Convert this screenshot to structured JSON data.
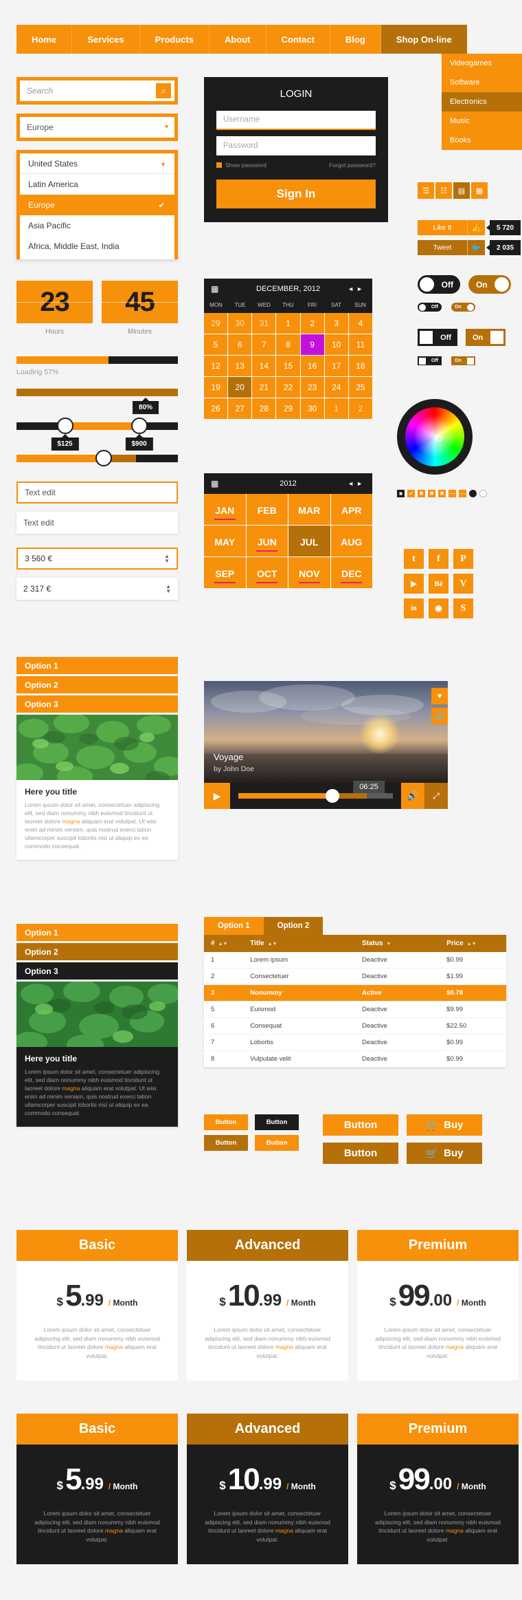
{
  "colors": {
    "accent": "#f7900b",
    "accent_dark": "#b5700a",
    "dark": "#1c1c1c",
    "magenta": "#c410d8"
  },
  "nav": {
    "items": [
      "Home",
      "Services",
      "Products",
      "About",
      "Contact",
      "Blog"
    ],
    "shop_label": "Shop On-line",
    "submenu": [
      "Videogames",
      "Software",
      "Electronics",
      "Music",
      "Books"
    ],
    "submenu_selected": "Electronics"
  },
  "search": {
    "placeholder": "Search",
    "icon": "search-icon"
  },
  "select": {
    "value": "Europe"
  },
  "dropdown": {
    "head": "United States",
    "items": [
      "Latin America",
      "Europe",
      "Asia Pacific",
      "Africa, Middle East, India"
    ],
    "selected": "Europe"
  },
  "timer": {
    "hours_value": "23",
    "hours_label": "Hours",
    "minutes_value": "45",
    "minutes_label": "Minutes"
  },
  "progress": {
    "percent": 57,
    "label": "Loading 57%"
  },
  "sliders": {
    "bar_full_pct": 100,
    "tooltip_80": "80%",
    "range_low": "$125",
    "range_low_pct": 30,
    "range_high": "$900",
    "range_high_pct": 76,
    "single_pct": 54
  },
  "inputs": {
    "text_focus": "Text edit",
    "text_plain": "Text edit",
    "spinner_orange": "3 560 €",
    "spinner_plain": "2 317 €"
  },
  "accordion_light": {
    "items": [
      "Option 1",
      "Option 2",
      "Option 3"
    ]
  },
  "accordion_dark": {
    "items": [
      "Option 1",
      "Option 2",
      "Option 3"
    ]
  },
  "card_light": {
    "title": "Here you title",
    "text_before": "Lorem ipsum dolor sit amet, consectetuer adipiscing elit, sed diam nonummy nibh euismod tincidunt ut laoreet dolore ",
    "highlight": "magna",
    "text_after": " aliquam erat volutpat. Ut wisi enim ad minim veniam, quis nostrud exerci tation ullamcorper suscipit lobortis nisl ut aliquip ex ea commodo consequat."
  },
  "card_dark": {
    "title": "Here you title",
    "text_before": "Lorem ipsum dolor sit amet, consectetuer adipiscing elit, sed diam nonummy nibh euismod tincidunt ut laoreet dolore ",
    "highlight": "magna",
    "text_after": " aliquam erat volutpat. Ut wisi enim ad minim veniam, quis nostrud exerci tation ullamcorper suscipit lobortis nisl ut aliquip ex ea commodo consequat."
  },
  "login": {
    "title": "LOGIN",
    "username_placeholder": "Username",
    "password_placeholder": "Password",
    "show_password": "Show password",
    "forgot": "Forgot password?",
    "submit": "Sign In"
  },
  "calendar": {
    "title": "DECEMBER, 2012",
    "icon": "calendar-icon",
    "prev": "◄",
    "next": "►",
    "dow": [
      "MON",
      "TUE",
      "WED",
      "THU",
      "FRI",
      "SAT",
      "SUN"
    ],
    "weeks": [
      [
        "29",
        "30",
        "31",
        "1",
        "2",
        "3",
        "4"
      ],
      [
        "5",
        "6",
        "7",
        "8",
        "9",
        "10",
        "11"
      ],
      [
        "12",
        "13",
        "14",
        "15",
        "16",
        "17",
        "18"
      ],
      [
        "19",
        "20",
        "21",
        "22",
        "23",
        "24",
        "25"
      ],
      [
        "26",
        "27",
        "28",
        "29",
        "30",
        "1",
        "2"
      ]
    ],
    "muted": [
      "29",
      "30",
      "31",
      "1",
      "2",
      "3",
      "4"
    ],
    "selected_day": "9",
    "hover_day": "20"
  },
  "monthpicker": {
    "title": "2012",
    "icon": "calendar-icon",
    "prev": "◄",
    "next": "►",
    "months": [
      "JAN",
      "FEB",
      "MAR",
      "APR",
      "MAY",
      "JUN",
      "JUL",
      "AUG",
      "SEP",
      "OCT",
      "NOV",
      "DEC"
    ],
    "hover_month": "JUL",
    "underlined": [
      "JAN",
      "JUN",
      "SEP",
      "OCT",
      "NOV",
      "DEC"
    ]
  },
  "viewtoggle": {
    "items": [
      "list-view-icon",
      "bullet-list-icon",
      "detail-list-icon",
      "grid-view-icon"
    ],
    "glyphs": [
      "☰",
      "☷",
      "▤",
      "▦"
    ],
    "selected_index": 2
  },
  "share": {
    "like_label": "Like It",
    "like_icon": "thumbs-up-icon",
    "like_count": "5 720",
    "tweet_label": "Tweet",
    "tweet_icon": "twitter-bird-icon",
    "tweet_count": "2 035"
  },
  "toggles": {
    "off_label": "Off",
    "on_label": "On"
  },
  "colorpicker": {
    "swatch_glyphs": [
      "■",
      "✔",
      "✖",
      "✖",
      "✖",
      "—",
      "—",
      "●",
      "○"
    ]
  },
  "social": {
    "row1": [
      "twitter-icon",
      "facebook-icon",
      "pinterest-icon"
    ],
    "row1_glyphs": [
      "t",
      "f",
      "P"
    ],
    "row2": [
      "youtube-icon",
      "behance-icon",
      "vimeo-icon"
    ],
    "row2_glyphs": [
      "▶",
      "Bē",
      "V"
    ],
    "row3": [
      "linkedin-icon",
      "dribbble-icon",
      "skype-icon"
    ],
    "row3_glyphs": [
      "in",
      "◉",
      "S"
    ]
  },
  "video": {
    "title": "Voyage",
    "author": "by John Doe",
    "time": "06:25",
    "play_icon": "play-icon",
    "sound_icon": "speaker-icon",
    "expand_icon": "expand-icon",
    "heart_icon": "heart-icon",
    "link_icon": "link-icon"
  },
  "table": {
    "tabs": [
      {
        "label": "Option 1",
        "active": true
      },
      {
        "label": "Option 2",
        "active": false
      }
    ],
    "columns": [
      "#",
      "Title",
      "Status",
      "Price"
    ],
    "rows": [
      {
        "num": "1",
        "title": "Lorem ipsum",
        "status": "Deactive",
        "price": "$0.99",
        "active": false
      },
      {
        "num": "2",
        "title": "Consectetuer",
        "status": "Deactive",
        "price": "$1.99",
        "active": false
      },
      {
        "num": "3",
        "title": "Nonummy",
        "status": "Active",
        "price": "$0.78",
        "active": true
      },
      {
        "num": "5",
        "title": "Euismod",
        "status": "Deactive",
        "price": "$9.99",
        "active": false
      },
      {
        "num": "6",
        "title": "Consequat",
        "status": "Deactive",
        "price": "$22.50",
        "active": false
      },
      {
        "num": "7",
        "title": "Lobortis",
        "status": "Deactive",
        "price": "$0.99",
        "active": false
      },
      {
        "num": "8",
        "title": "Vulputate velit",
        "status": "Deactive",
        "price": "$0.99",
        "active": false
      }
    ]
  },
  "buttons": {
    "small": "Button",
    "large": "Button",
    "buy": "Buy",
    "cart_icon": "shopping-cart-icon"
  },
  "pricing_light": [
    {
      "name": "Basic",
      "style": "orange",
      "currency": "$",
      "integer": "5",
      "decimal": ".99",
      "period": "/ Month",
      "text_before": "Lorem ipsum dolor sit amet, consectetuer adipiscing elit, sed diam nonummy nibh euismod tincidunt ut laoreet dolore ",
      "highlight": "magna",
      "text_after": " aliquam erat volutpat."
    },
    {
      "name": "Advanced",
      "style": "dark",
      "currency": "$",
      "integer": "10",
      "decimal": ".99",
      "period": "/ Month",
      "text_before": "Lorem ipsum dolor sit amet, consectetuer adipiscing elit, sed diam nonummy nibh euismod tincidunt ut laoreet dolore ",
      "highlight": "magna",
      "text_after": " aliquam erat volutpat."
    },
    {
      "name": "Premium",
      "style": "orange",
      "currency": "$",
      "integer": "99",
      "decimal": ".00",
      "period": "/ Month",
      "text_before": "Lorem ipsum dolor sit amet, consectetuer adipiscing elit, sed diam nonummy nibh euismod tincidunt ut laoreet dolore ",
      "highlight": "magna",
      "text_after": " aliquam erat volutpat."
    }
  ],
  "pricing_dark": [
    {
      "name": "Basic",
      "style": "orange",
      "currency": "$",
      "integer": "5",
      "decimal": ".99",
      "period": "/ Month",
      "text_before": "Lorem ipsum dolor sit amet, consectetuer adipiscing elit, sed diam nonummy nibh euismod tincidunt ut laoreet dolore ",
      "highlight": "magna",
      "text_after": " aliquam erat volutpat."
    },
    {
      "name": "Advanced",
      "style": "dark",
      "currency": "$",
      "integer": "10",
      "decimal": ".99",
      "period": "/ Month",
      "text_before": "Lorem ipsum dolor sit amet, consectetuer adipiscing elit, sed diam nonummy nibh euismod tincidunt ut laoreet dolore ",
      "highlight": "magna",
      "text_after": " aliquam erat volutpat."
    },
    {
      "name": "Premium",
      "style": "orange",
      "currency": "$",
      "integer": "99",
      "decimal": ".00",
      "period": "/ Month",
      "text_before": "Lorem ipsum dolor sit amet, consectetuer adipiscing elit, sed diam nonummy nibh euismod tincidunt ut laoreet dolore ",
      "highlight": "magna",
      "text_after": " aliquam erat volutpat."
    }
  ]
}
